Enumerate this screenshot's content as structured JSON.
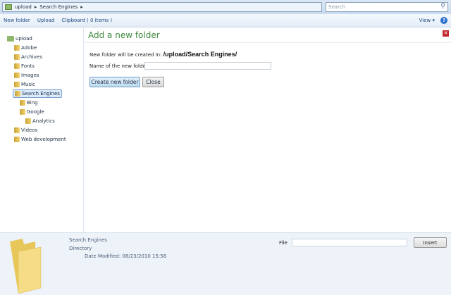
{
  "address": {
    "crumbs": [
      "upload",
      "Search Engines"
    ],
    "search_placeholder": "Search"
  },
  "toolbar": {
    "new_folder": "New folder",
    "upload": "Upload",
    "clipboard": "Clipboard ( 0 items )",
    "view": "View"
  },
  "tree": [
    {
      "label": "upload",
      "level": 0
    },
    {
      "label": "Adobe",
      "level": 1
    },
    {
      "label": "Archives",
      "level": 1
    },
    {
      "label": "Fonts",
      "level": 1
    },
    {
      "label": "Images",
      "level": 1
    },
    {
      "label": "Music",
      "level": 1
    },
    {
      "label": "Search Engines",
      "level": 1,
      "selected": true
    },
    {
      "label": "Bing",
      "level": 2
    },
    {
      "label": "Google",
      "level": 2
    },
    {
      "label": "Analytics",
      "level": 3
    },
    {
      "label": "Videos",
      "level": 1
    },
    {
      "label": "Web development",
      "level": 1
    }
  ],
  "dialog": {
    "title": "Add a new folder",
    "location_label": "New folder will be created in:",
    "location_path": "/upload/Search Engines/",
    "name_label": "Name of the new folder:",
    "name_value": "",
    "create_button": "Create new folder",
    "close_button": "Close"
  },
  "details": {
    "name": "Search Engines",
    "type": "Directory",
    "date_label": "Date Modified:",
    "date_value": "08/23/2010 15:56",
    "file_label": "File",
    "file_value": "",
    "insert_button": "Insert"
  }
}
